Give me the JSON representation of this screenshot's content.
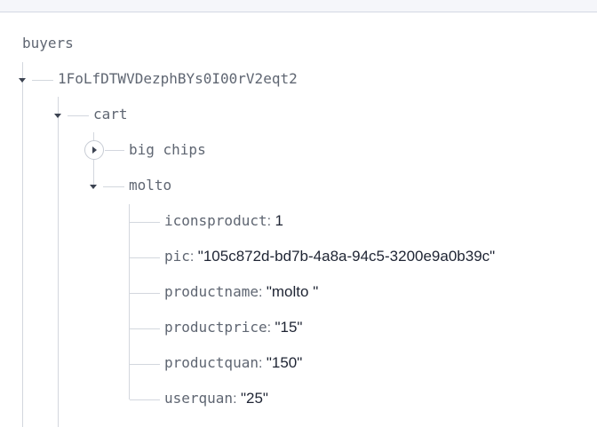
{
  "tree": {
    "root_label": "buyers",
    "buyer_id": "1FoLfDTWVDezphBYs0I00rV2eqt2",
    "cart_label": "cart",
    "collapsed_item": "big chips",
    "expanded_item": "molto",
    "fields": [
      {
        "key": "iconsproduct",
        "value": "1"
      },
      {
        "key": "pic",
        "value": "\"105c872d-bd7b-4a8a-94c5-3200e9a0b39c\""
      },
      {
        "key": "productname",
        "value": "\"molto \""
      },
      {
        "key": "productprice",
        "value": "\"15\""
      },
      {
        "key": "productquan",
        "value": "\"150\""
      },
      {
        "key": "userquan",
        "value": "\"25\""
      }
    ]
  }
}
